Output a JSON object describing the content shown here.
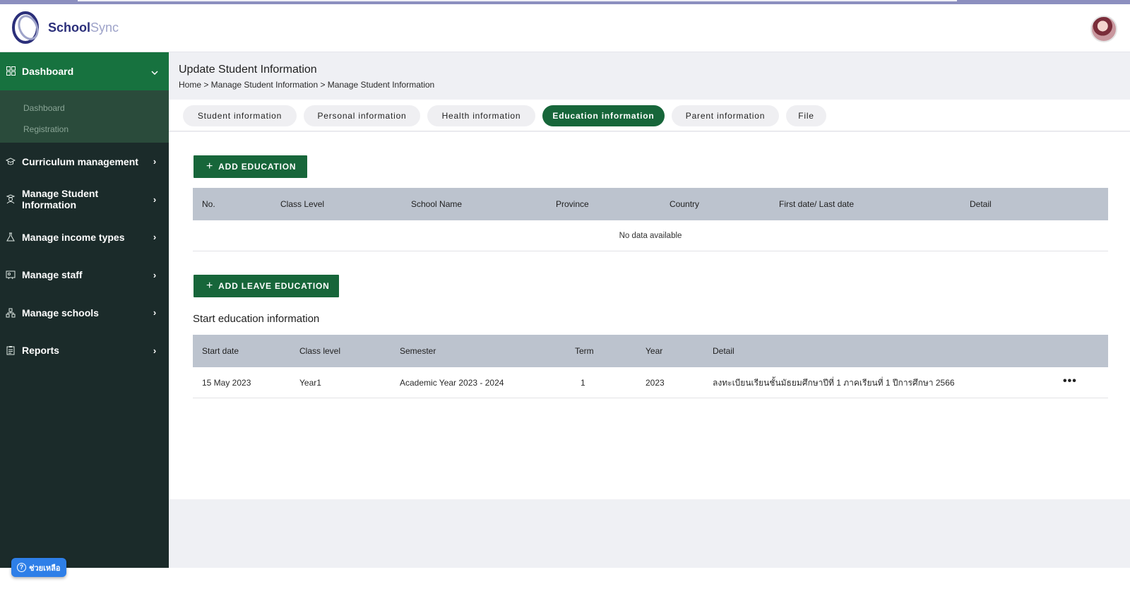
{
  "app": {
    "logo_text_primary": "School",
    "logo_text_secondary": "Sync"
  },
  "sidebar": {
    "active": {
      "label": "Dashboard",
      "icon": "grid-icon",
      "chevron": "⌄"
    },
    "sub_items": [
      {
        "label": "Dashboard"
      },
      {
        "label": "Registration"
      }
    ],
    "items": [
      {
        "label": "Curriculum management",
        "icon": "graduation-cap-icon"
      },
      {
        "label": "Manage Student Information",
        "icon": "student-icon"
      },
      {
        "label": "Manage income types",
        "icon": "flask-icon"
      },
      {
        "label": "Manage staff",
        "icon": "board-icon"
      },
      {
        "label": "Manage schools",
        "icon": "school-network-icon"
      },
      {
        "label": "Reports",
        "icon": "clipboard-icon"
      }
    ],
    "chevron": "›"
  },
  "help": {
    "label": "ช่วยเหลือ",
    "icon": "?"
  },
  "page": {
    "title": "Update Student Information",
    "breadcrumb": "Home > Manage Student Information > Manage Student Information"
  },
  "tabs": [
    {
      "label": "Student information"
    },
    {
      "label": "Personal information"
    },
    {
      "label": "Health information"
    },
    {
      "label": "Education information",
      "active": true
    },
    {
      "label": "Parent information"
    },
    {
      "label": "File"
    }
  ],
  "education": {
    "add_button": "ADD EDUCATION",
    "plus": "+",
    "columns": [
      "No.",
      "Class Level",
      "School Name",
      "Province",
      "Country",
      "First date/ Last date",
      "Detail"
    ],
    "empty_text": "No data available"
  },
  "leave": {
    "add_button": "ADD LEAVE EDUCATION"
  },
  "start_education": {
    "title": "Start education information",
    "columns": [
      "Start date",
      "Class level",
      "Semester",
      "Term",
      "Year",
      "Detail"
    ],
    "rows": [
      {
        "start_date": "15 May 2023",
        "class_level": "Year1",
        "semester": "Academic Year 2023 - 2024",
        "term": "1",
        "year": "2023",
        "detail": "ลงทะเบียนเรียนชั้นมัธยมศึกษาปีที่ 1 ภาคเรียนที่ 1 ปีการศึกษา 2566",
        "more": "•••"
      }
    ]
  },
  "colors": {
    "brand_green": "#17663a",
    "sidebar_bg": "#1b2b2a",
    "table_header": "#bcc3ce"
  }
}
